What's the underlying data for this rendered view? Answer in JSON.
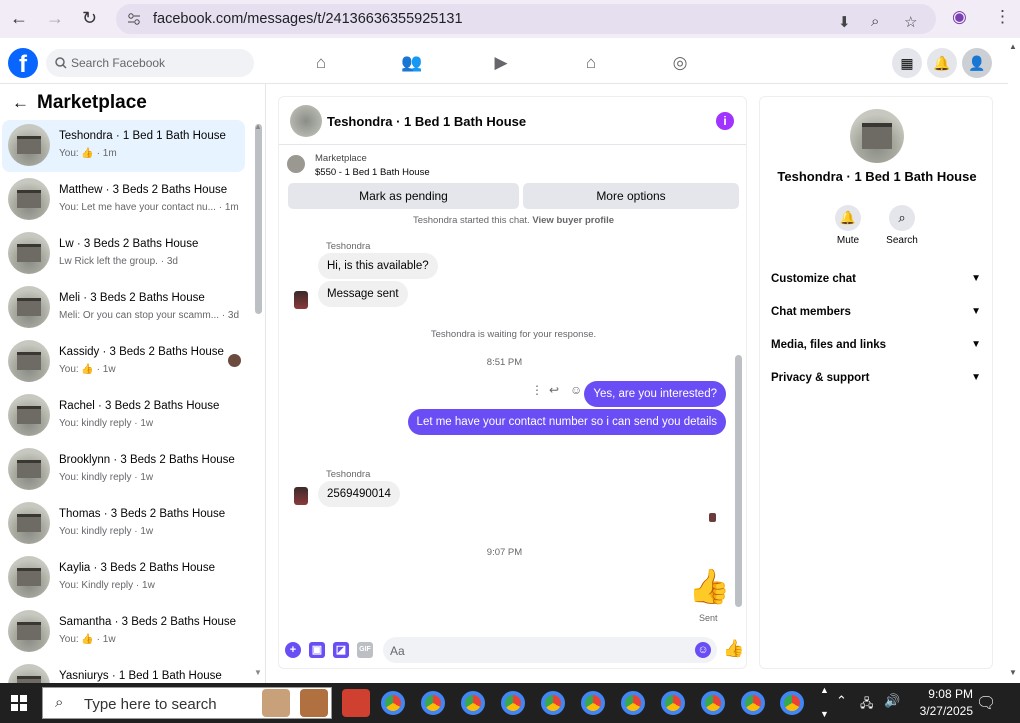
{
  "browser": {
    "url": "facebook.com/messages/t/24136636355925131",
    "back_icon": "←",
    "forward_icon": "→",
    "reload_icon": "↻"
  },
  "fb": {
    "search_placeholder": "Search Facebook"
  },
  "left": {
    "title": "Marketplace",
    "conversations": [
      {
        "title": "Teshondra · 1 Bed 1 Bath House",
        "snippet": "You: 👍 · 1m",
        "active": true
      },
      {
        "title": "Matthew · 3 Beds 2 Baths House",
        "snippet": "You: Let me have your contact nu... · 1m"
      },
      {
        "title": "Lw · 3 Beds 2 Baths House",
        "snippet": "Lw Rick left the group. · 3d"
      },
      {
        "title": "Meli · 3 Beds 2 Baths House",
        "snippet": "Meli: Or you can stop your scamm... · 3d"
      },
      {
        "title": "Kassidy · 3 Beds 2 Baths House",
        "snippet": "You: 👍 · 1w"
      },
      {
        "title": "Rachel · 3 Beds 2 Baths House",
        "snippet": "You: kindly reply · 1w"
      },
      {
        "title": "Brooklynn · 3 Beds 2 Baths House",
        "snippet": "You: kindly reply · 1w"
      },
      {
        "title": "Thomas · 3 Beds 2 Baths House",
        "snippet": "You: kindly reply · 1w"
      },
      {
        "title": "Kaylia · 3 Beds 2 Baths House",
        "snippet": "You: Kindly reply · 1w"
      },
      {
        "title": "Samantha · 3 Beds 2 Baths House",
        "snippet": "You: 👍 · 1w"
      },
      {
        "title": "Yasniurys · 1 Bed 1 Bath House",
        "snippet": ""
      }
    ]
  },
  "chat": {
    "name": "Teshondra · 1 Bed 1 Bath House",
    "marketplace_label": "Marketplace",
    "listing": "$550 - 1 Bed 1 Bath House",
    "mark_pending": "Mark as pending",
    "more_options": "More options",
    "started_text": "Teshondra started this chat.",
    "view_buyer": "View buyer profile",
    "sender_name_1": "Teshondra",
    "msg_in_1": "Hi, is this available?",
    "msg_in_2": "Message sent",
    "waiting": "Teshondra is waiting for your response.",
    "time_1": "8:51 PM",
    "msg_out_1": "Yes, are you interested?",
    "msg_out_2": "Let me have your contact number so i can send you details",
    "sender_name_2": "Teshondra",
    "msg_in_3": "2569490014",
    "time_2": "9:07 PM",
    "sent_label": "Sent",
    "composer_placeholder": "Aa"
  },
  "details": {
    "name": "Teshondra · 1 Bed 1 Bath House",
    "mute": "Mute",
    "search": "Search",
    "sections": [
      "Customize chat",
      "Chat members",
      "Media, files and links",
      "Privacy & support"
    ]
  },
  "taskbar": {
    "search_placeholder": "Type here to search",
    "time": "9:08 PM",
    "date": "3/27/2025"
  },
  "colors": {
    "brand": "#0866ff",
    "accent": "#6a4df5"
  }
}
